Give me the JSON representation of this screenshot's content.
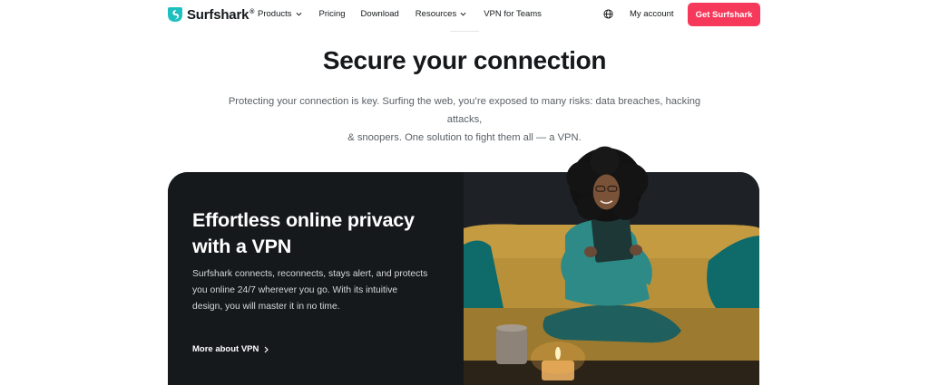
{
  "nav": {
    "logo": "Surfshark",
    "logo_mark": "®",
    "links": [
      {
        "label": "Products",
        "dropdown": true
      },
      {
        "label": "Pricing",
        "dropdown": false
      },
      {
        "label": "Download",
        "dropdown": false
      },
      {
        "label": "Resources",
        "dropdown": true
      },
      {
        "label": "VPN for Teams",
        "dropdown": false
      }
    ],
    "language_icon": "globe-icon",
    "account": "My account",
    "cta": "Get Surfshark"
  },
  "hero": {
    "title": "Secure your connection",
    "subtitle_line1": "Protecting your connection is key. Surfing the web, you’re exposed to many risks: data breaches, hacking attacks,",
    "subtitle_line2": "& snoopers. One solution to fight them all — a VPN."
  },
  "card": {
    "title_line1": "Effortless online privacy",
    "title_line2": "with a VPN",
    "body_line1": "Surfshark connects, reconnects, stays alert, and protects",
    "body_line2": "you online 24/7 wherever you go. With its intuitive",
    "body_line3": "design, you will master it in no time.",
    "link": "More about VPN",
    "link_icon": "chevron-right-icon"
  },
  "colors": {
    "brand": "#1ebfbf",
    "accent": "#f6385a",
    "dark": "#16191c",
    "muted": "#5b6066"
  }
}
